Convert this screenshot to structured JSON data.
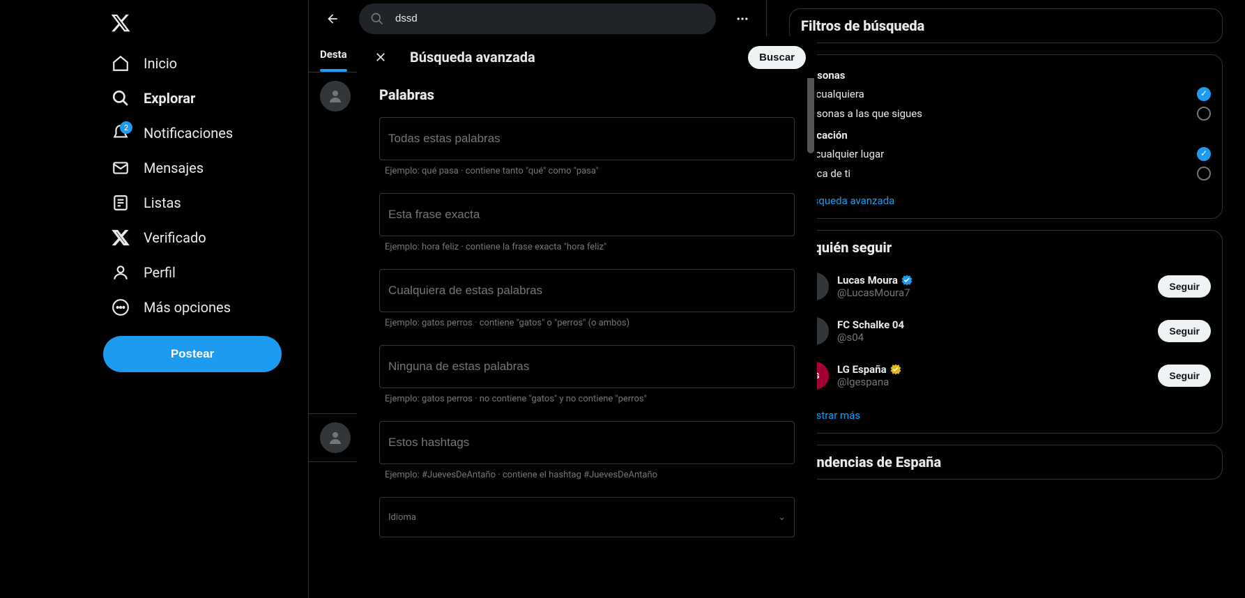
{
  "nav": {
    "items": [
      {
        "label": "Inicio"
      },
      {
        "label": "Explorar"
      },
      {
        "label": "Notificaciones",
        "badge": "2"
      },
      {
        "label": "Mensajes"
      },
      {
        "label": "Listas"
      },
      {
        "label": "Verificado"
      },
      {
        "label": "Perfil"
      },
      {
        "label": "Más opciones"
      }
    ],
    "post_button": "Postear"
  },
  "search": {
    "value": "dssd"
  },
  "tabs": {
    "active": "Desta"
  },
  "modal": {
    "title": "Búsqueda avanzada",
    "search_button": "Buscar",
    "words_heading": "Palabras",
    "fields": [
      {
        "placeholder": "Todas estas palabras",
        "hint": "Ejemplo: qué pasa · contiene tanto \"qué\" como \"pasa\""
      },
      {
        "placeholder": "Esta frase exacta",
        "hint": "Ejemplo: hora feliz · contiene la frase exacta \"hora feliz\""
      },
      {
        "placeholder": "Cualquiera de estas palabras",
        "hint": "Ejemplo: gatos perros · contiene \"gatos\" o \"perros\" (o ambos)"
      },
      {
        "placeholder": "Ninguna de estas palabras",
        "hint": "Ejemplo: gatos perros · no contiene \"gatos\" y no contiene \"perros\""
      },
      {
        "placeholder": "Estos hashtags",
        "hint": "Ejemplo: #JuevesDeAntaño · contiene el hashtag #JuevesDeAntaño"
      }
    ],
    "language_label": "Idioma"
  },
  "filters": {
    "title": "Filtros de búsqueda",
    "persons": {
      "title": "Personas",
      "opt1": "De cualquiera",
      "opt2": "Personas a las que sigues"
    },
    "location": {
      "title": "Ubicación",
      "opt1": "En cualquier lugar",
      "opt2": "Cerca de ti"
    },
    "advanced_link": "Búsqueda avanzada"
  },
  "follow": {
    "title": "A quién seguir",
    "accounts": [
      {
        "name": "Lucas Moura",
        "handle": "@LucasMoura7",
        "verified": "blue"
      },
      {
        "name": "FC Schalke 04",
        "handle": "@s04",
        "verified": "none"
      },
      {
        "name": "LG España",
        "handle": "@lgespana",
        "verified": "gold"
      }
    ],
    "follow_button": "Seguir",
    "show_more": "Mostrar más"
  },
  "trends": {
    "title": "Tendencias de España"
  }
}
